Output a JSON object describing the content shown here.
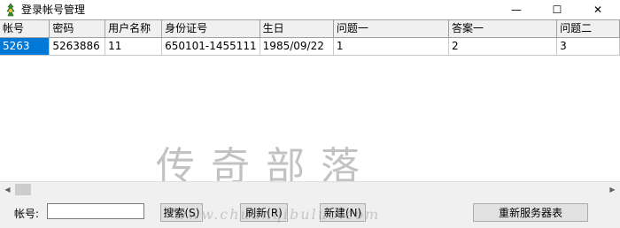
{
  "window": {
    "title": "登录帐号管理",
    "minimize_glyph": "—",
    "maximize_glyph": "☐",
    "close_glyph": "✕"
  },
  "table": {
    "columns": [
      "帐号",
      "密码",
      "用户名称",
      "身份证号",
      "生日",
      "问题一",
      "答案一",
      "问题二"
    ],
    "rows": [
      [
        "5263",
        "5263886",
        "11",
        "650101-1455111",
        "1985/09/22",
        "1",
        "2",
        "3"
      ]
    ],
    "selected_cell_color": "#0078d7"
  },
  "scrollbar": {
    "left_arrow": "◀",
    "right_arrow": "▶"
  },
  "form": {
    "account_label": "帐号:",
    "account_value": "",
    "search_button": "搜索(S)",
    "refresh_button": "刷新(R)",
    "add_button": "新建(N)",
    "restart_button": "重新服务器表"
  },
  "watermark": {
    "text": "传奇部落",
    "url": "www.chuanqibuluo.com"
  }
}
